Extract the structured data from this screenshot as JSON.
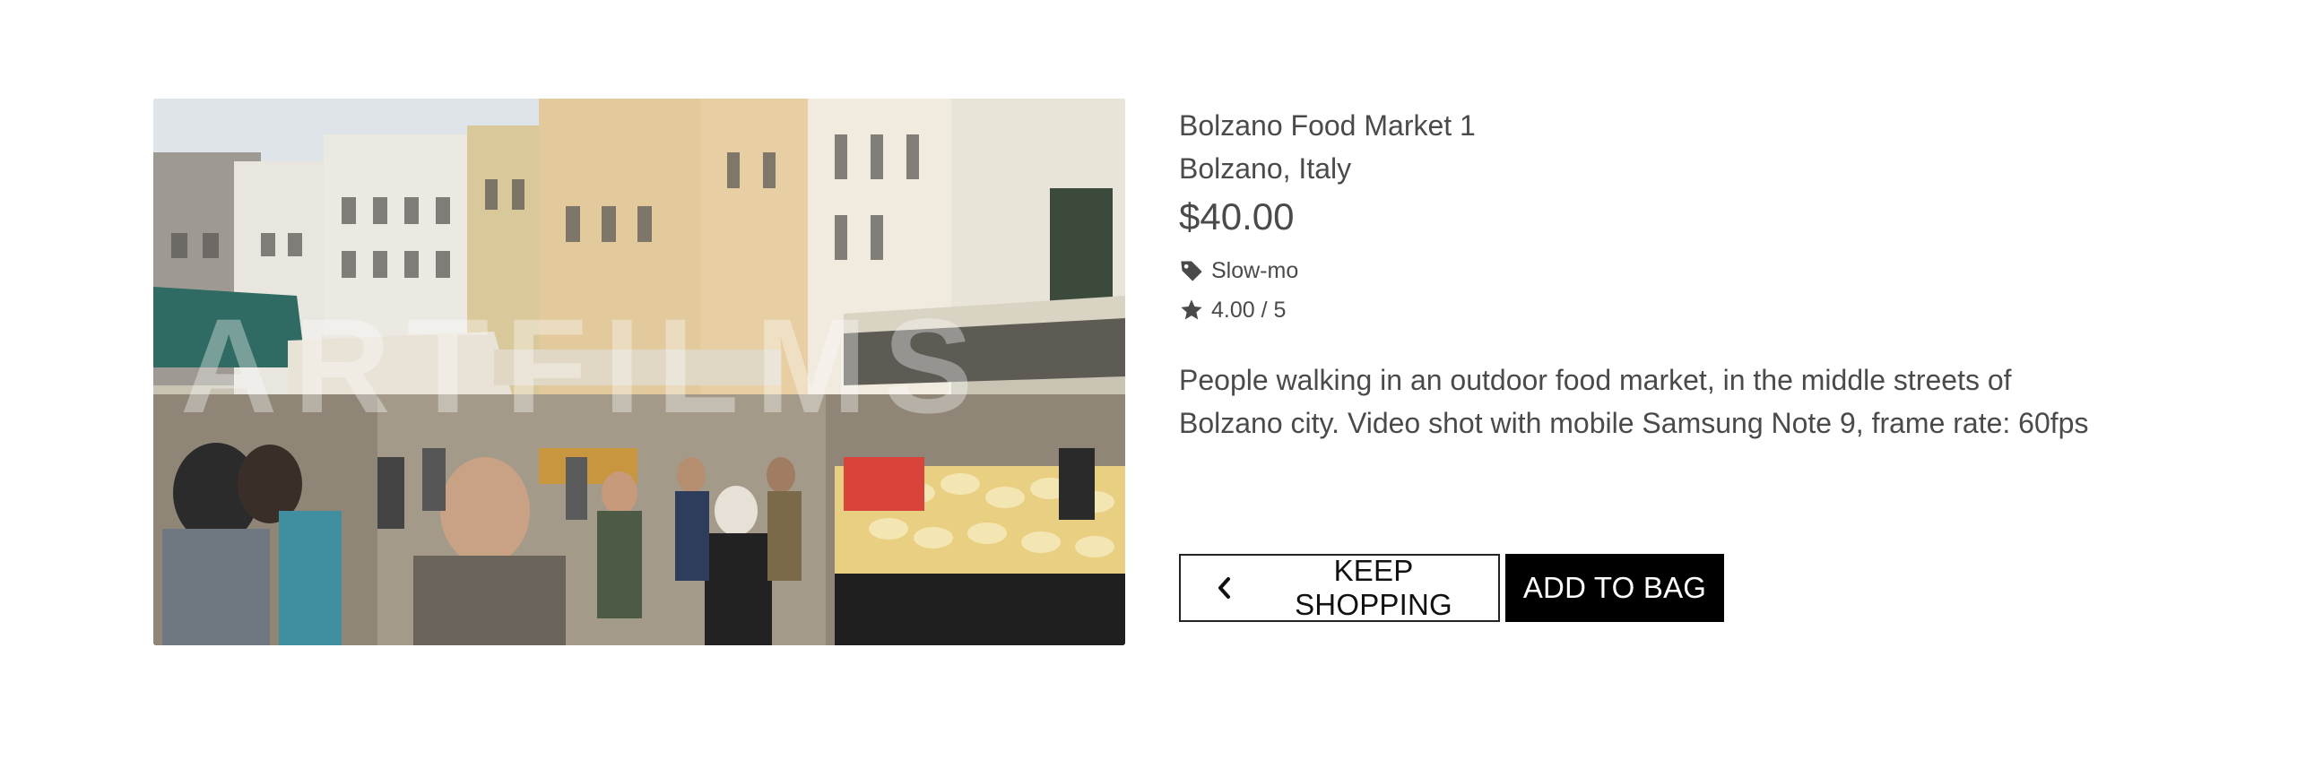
{
  "product": {
    "title": "Bolzano Food Market 1",
    "location": "Bolzano, Italy",
    "price": "$40.00",
    "category": "Slow-mo",
    "rating": "4.00 / 5",
    "description": "People walking in an outdoor food market, in the middle streets of Bolzano city. Video shot with mobile Samsung Note 9, frame rate: 60fps",
    "image_watermark": "ARTFILMS"
  },
  "icons": {
    "category": "tag-icon",
    "rating": "star-icon",
    "back": "chevron-left-icon"
  },
  "actions": {
    "keep_shopping": "KEEP SHOPPING",
    "add_to_bag": "ADD TO BAG"
  },
  "colors": {
    "text": "#4a4a4a",
    "primary_button_bg": "#000000",
    "primary_button_text": "#ffffff",
    "secondary_button_border": "#222222"
  }
}
